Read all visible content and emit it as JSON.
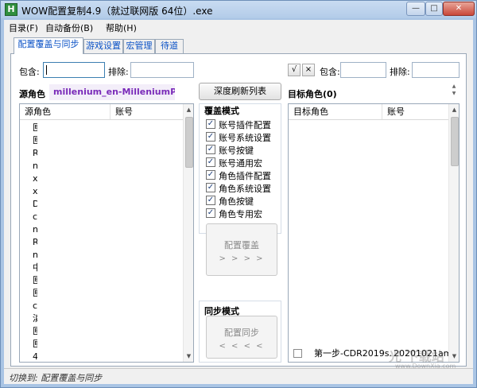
{
  "window": {
    "title": "WOW配置复制4.9（就过联网版 64位）.exe",
    "app_icon": "H",
    "controls": {
      "minimize": "—",
      "maximize": "□",
      "close": "✕"
    }
  },
  "menu": [
    {
      "label": "目录(F)"
    },
    {
      "label": "自动备份(B)"
    },
    {
      "label": "帮助(H)"
    }
  ],
  "tabs": [
    {
      "label": "配置覆盖与同步",
      "active": true
    },
    {
      "label": "游戏设置",
      "active": false
    },
    {
      "label": "宏管理",
      "active": false
    },
    {
      "label": "待道",
      "active": false
    }
  ],
  "left_filter": {
    "include_label": "包含:",
    "include_value": "",
    "exclude_label": "排除:",
    "exclude_value": ""
  },
  "source": {
    "label": "源角色",
    "value": "millenium_en-MilleniumPanel"
  },
  "deep_refresh_button": "深度刷新列表",
  "right_filter": {
    "check_btn": "√",
    "x_btn": "×",
    "include_label": "包含:",
    "include_value": "",
    "exclude_label": "排除:",
    "exclude_value": ""
  },
  "target": {
    "label": "目标角色(0)"
  },
  "source_list": {
    "columns": [
      "源角色",
      "账号"
    ],
    "row_markers": [
      "匣",
      "匣",
      "R",
      "n",
      "x",
      "x",
      "D",
      "c",
      "n",
      "R",
      "n",
      "中",
      "匣",
      "匣",
      "c",
      "滇",
      "匣",
      "匣",
      "4"
    ]
  },
  "target_list": {
    "columns": [
      "目标角色",
      "账号"
    ],
    "last_row": {
      "name": "第一步-CDR2019s.",
      "account": "20201021am"
    }
  },
  "overwrite_mode": {
    "title": "覆盖模式",
    "options": [
      {
        "label": "账号插件配置",
        "checked": true
      },
      {
        "label": "账号系统设置",
        "checked": true
      },
      {
        "label": "账号按键",
        "checked": true
      },
      {
        "label": "账号通用宏",
        "checked": true
      },
      {
        "label": "角色插件配置",
        "checked": true
      },
      {
        "label": "角色系统设置",
        "checked": true
      },
      {
        "label": "角色按键",
        "checked": true
      },
      {
        "label": "角色专用宏",
        "checked": true
      }
    ],
    "button_label": "配置覆盖",
    "button_arrows": "> > > >"
  },
  "sync_mode": {
    "title": "同步模式",
    "button_label": "配置同步",
    "button_arrows": "< < < <"
  },
  "status": {
    "text": "切换到: 配置覆盖与同步"
  },
  "watermark": {
    "text": "光 下载站",
    "sub": "www.DownXia.com"
  }
}
